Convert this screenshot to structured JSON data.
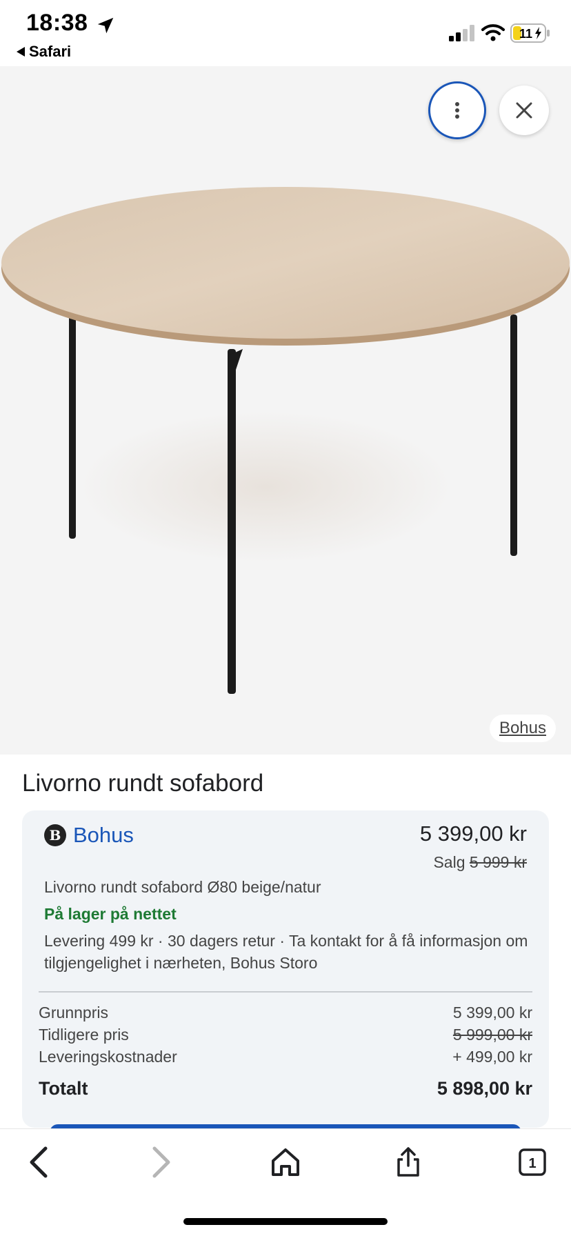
{
  "status_bar": {
    "time": "18:38",
    "back_app": "Safari",
    "battery": "11"
  },
  "image_viewer": {
    "source_label": "Bohus",
    "more_icon": "more-vertical-icon",
    "close_icon": "close-icon"
  },
  "product": {
    "title": "Livorno rundt sofabord",
    "merchant": {
      "logo_letter": "B",
      "name": "Bohus"
    },
    "price": "5 399,00 kr",
    "sale_label": "Salg",
    "old_price": "5 999 kr",
    "description": "Livorno rundt sofabord Ø80 beige/natur",
    "stock": "På lager på nettet",
    "delivery": "Levering 499 kr · 30 dagers retur · Ta kontakt for å få informasjon om tilgjengelighet i nærheten, Bohus Storo",
    "breakdown": {
      "base_label": "Grunnpris",
      "base_value": "5 399,00 kr",
      "previous_label": "Tidligere pris",
      "previous_value": "5 999,00 kr",
      "shipping_label": "Leveringskostnader",
      "shipping_value": "+ 499,00 kr",
      "total_label": "Totalt",
      "total_value": "5 898,00 kr"
    }
  },
  "toolbar": {
    "back_icon": "chevron-left-icon",
    "forward_icon": "chevron-right-icon",
    "home_icon": "home-icon",
    "share_icon": "share-icon",
    "tabs_count": "1"
  },
  "colors": {
    "accent": "#1a56b8",
    "stock_green": "#1e7a34",
    "card_bg": "#f1f4f7"
  }
}
